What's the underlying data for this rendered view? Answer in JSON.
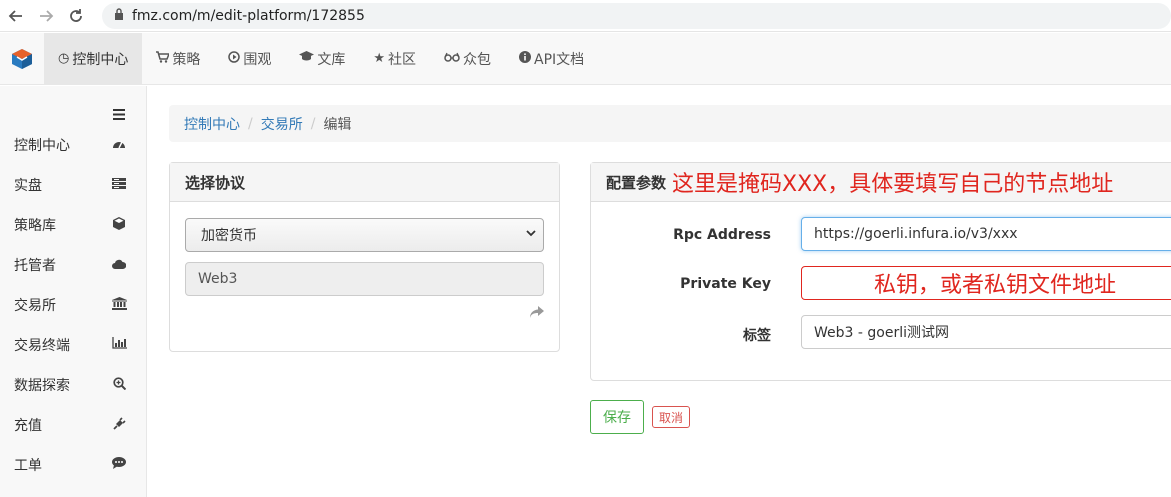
{
  "browser": {
    "url": "fmz.com/m/edit-platform/172855"
  },
  "topnav": {
    "items": [
      {
        "icon": "clock-icon",
        "glyph": "◷",
        "label": "控制中心",
        "active": true
      },
      {
        "icon": "cart-icon",
        "glyph": "🛒",
        "label": "策略"
      },
      {
        "icon": "play-circle-icon",
        "glyph": "▷",
        "label": "围观"
      },
      {
        "icon": "graduation-cap-icon",
        "glyph": "🎓",
        "label": "文库"
      },
      {
        "icon": "star-icon",
        "glyph": "★",
        "label": "社区"
      },
      {
        "icon": "glasses-icon",
        "glyph": "◔◔",
        "label": "众包"
      },
      {
        "icon": "info-icon",
        "glyph": "ℹ",
        "label": "API文档"
      }
    ]
  },
  "sidebar": {
    "items": [
      {
        "label": "控制中心",
        "icon": "dashboard-icon",
        "glyph": "◕"
      },
      {
        "label": "实盘",
        "icon": "server-icon",
        "glyph": "▤"
      },
      {
        "label": "策略库",
        "icon": "cube-icon",
        "glyph": "◈"
      },
      {
        "label": "托管者",
        "icon": "cloud-icon",
        "glyph": "☁"
      },
      {
        "label": "交易所",
        "icon": "bank-icon",
        "glyph": "🏛"
      },
      {
        "label": "交易终端",
        "icon": "bar-chart-icon",
        "glyph": "▥"
      },
      {
        "label": "数据探索",
        "icon": "search-plus-icon",
        "glyph": "⊕"
      },
      {
        "label": "充值",
        "icon": "plug-icon",
        "glyph": "🔌"
      },
      {
        "label": "工单",
        "icon": "comment-icon",
        "glyph": "💬"
      }
    ]
  },
  "breadcrumb": {
    "items": [
      "控制中心",
      "交易所"
    ],
    "current": "编辑"
  },
  "protocol_panel": {
    "title": "选择协议",
    "select_value": "加密货币",
    "readonly_value": "Web3"
  },
  "config_panel": {
    "title": "配置参数",
    "annotation": "这里是掩码XXX，具体要填写自己的节点地址",
    "fields": [
      {
        "label": "Rpc Address",
        "value": "https://goerli.infura.io/v3/xxx"
      },
      {
        "label": "Private Key",
        "annotation": "私钥，或者私钥文件地址"
      },
      {
        "label": "标签",
        "value": "Web3 - goerli测试网"
      }
    ]
  },
  "actions": {
    "save": "保存",
    "cancel": "取消"
  },
  "colors": {
    "annotation_red": "#e0261f",
    "link_blue": "#337ab7",
    "save_green": "#4cae4c",
    "cancel_red": "#d9534f"
  }
}
